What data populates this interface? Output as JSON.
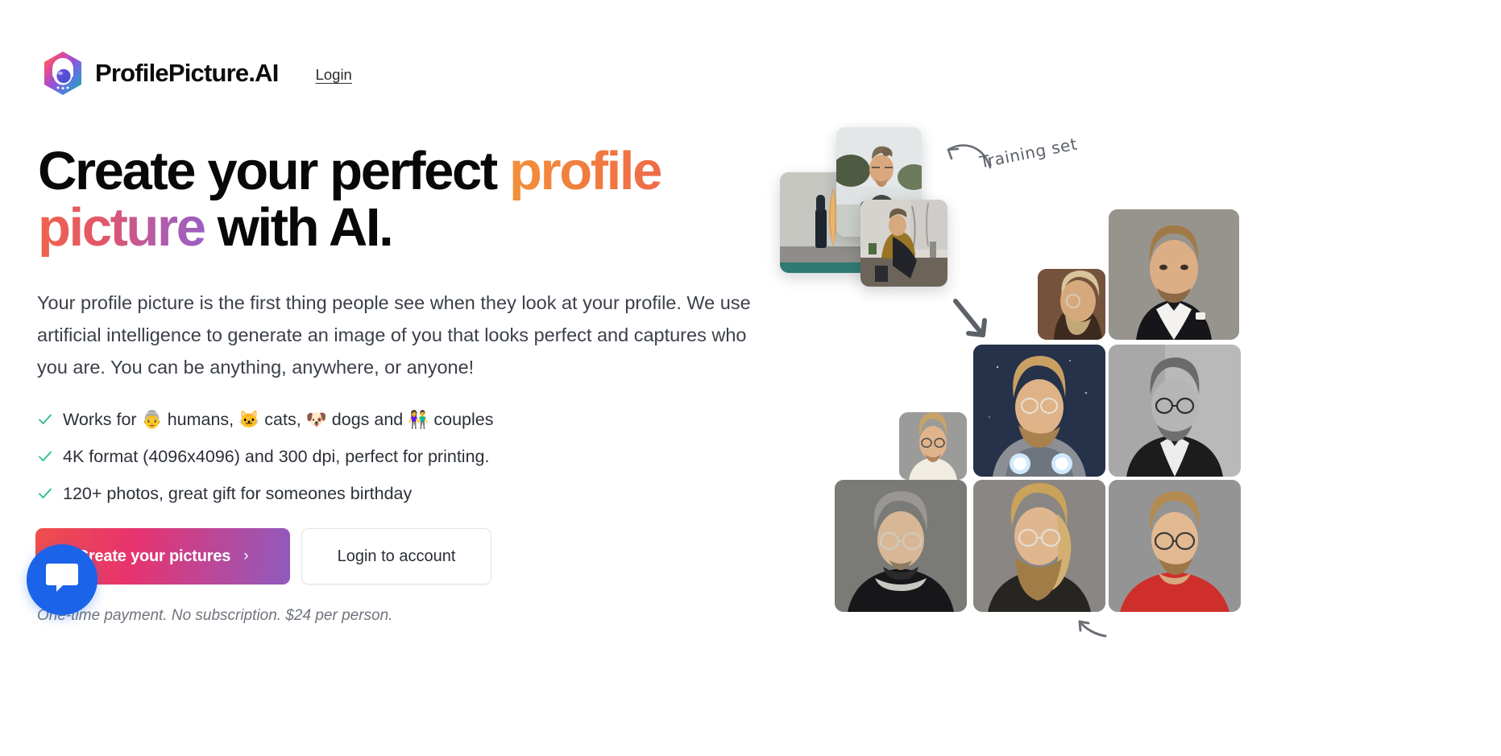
{
  "header": {
    "brand_name": "ProfilePicture.AI",
    "logo_icon": "astronaut-hexagon-logo",
    "login_link": "Login"
  },
  "hero": {
    "headline_part1": "Create your perfect ",
    "headline_gradient1": "profile",
    "headline_gradient2": "picture",
    "headline_part2": " with AI.",
    "paragraph": "Your profile picture is the first thing people see when they look at your profile. We use artificial intelligence to generate an image of you that looks perfect and captures who you are. You can be anything, anywhere, or anyone!",
    "features": [
      {
        "check_icon": "check-icon",
        "segments": [
          {
            "type": "text",
            "value": "Works for "
          },
          {
            "type": "emoji",
            "value": "👵",
            "name": "older-person-emoji"
          },
          {
            "type": "text",
            "value": " humans, "
          },
          {
            "type": "emoji",
            "value": "🐱",
            "name": "cat-face-emoji"
          },
          {
            "type": "text",
            "value": " cats, "
          },
          {
            "type": "emoji",
            "value": "🐶",
            "name": "dog-face-emoji"
          },
          {
            "type": "text",
            "value": " dogs and "
          },
          {
            "type": "emoji",
            "value": "👫",
            "name": "couple-emoji"
          },
          {
            "type": "text",
            "value": " couples"
          }
        ],
        "plain": "Works for humans, cats, dogs and couples"
      },
      {
        "check_icon": "check-icon",
        "segments": [
          {
            "type": "text",
            "value": "4K format (4096x4096) and 300 dpi, perfect for printing."
          }
        ],
        "plain": "4K format (4096x4096) and 300 dpi, perfect for printing."
      },
      {
        "check_icon": "check-icon",
        "segments": [
          {
            "type": "text",
            "value": "120+ photos, great gift for someones birthday"
          }
        ],
        "plain": "120+ photos, great gift for someones birthday"
      }
    ],
    "primary_button": "Create your pictures",
    "primary_button_chevron": "›",
    "secondary_button": "Login to account",
    "fineprint": "One-time payment. No subscription. $24 per person."
  },
  "collage": {
    "training_set_label": "Training set",
    "arrow_curved_icon": "curved-arrow-icon",
    "arrow_diagonal_icon": "diagonal-arrow-icon",
    "arrow_small_icon": "small-arrow-icon",
    "training_photos": [
      {
        "name": "training-photo-skater",
        "alt": "person with surfboard against concrete wall"
      },
      {
        "name": "training-photo-standing",
        "alt": "bearded man with arms crossed outdoors"
      },
      {
        "name": "training-photo-sitting",
        "alt": "man in mustard sweater sitting by window"
      }
    ],
    "generated_photos": [
      {
        "name": "generated-photo-tuxedo",
        "alt": "man in black tuxedo with bow tie"
      },
      {
        "name": "generated-photo-profile-warm",
        "alt": "side profile portrait warm tones"
      },
      {
        "name": "generated-photo-scifi",
        "alt": "sci-fi armored character with glowing lights"
      },
      {
        "name": "generated-photo-bw-suit",
        "alt": "black and white portrait in suit and glasses"
      },
      {
        "name": "generated-photo-white-coat",
        "alt": "man in white fur collar coat"
      },
      {
        "name": "generated-photo-monk",
        "alt": "older man with grey hair in dark robe"
      },
      {
        "name": "generated-photo-longbeard",
        "alt": "blonde man with long beard and glasses"
      },
      {
        "name": "generated-photo-redshirt",
        "alt": "man in red shirt with glasses"
      }
    ]
  },
  "chat": {
    "icon": "chat-bubble-icon",
    "label": "Open chat"
  },
  "colors": {
    "accent_orange": "#F3903A",
    "accent_pink": "#E8336E",
    "accent_purple": "#8E5BBE",
    "check_green": "#2FBE8F",
    "chat_blue": "#1B63E8",
    "text_dark": "#08080A",
    "text_body": "#3B4049"
  }
}
